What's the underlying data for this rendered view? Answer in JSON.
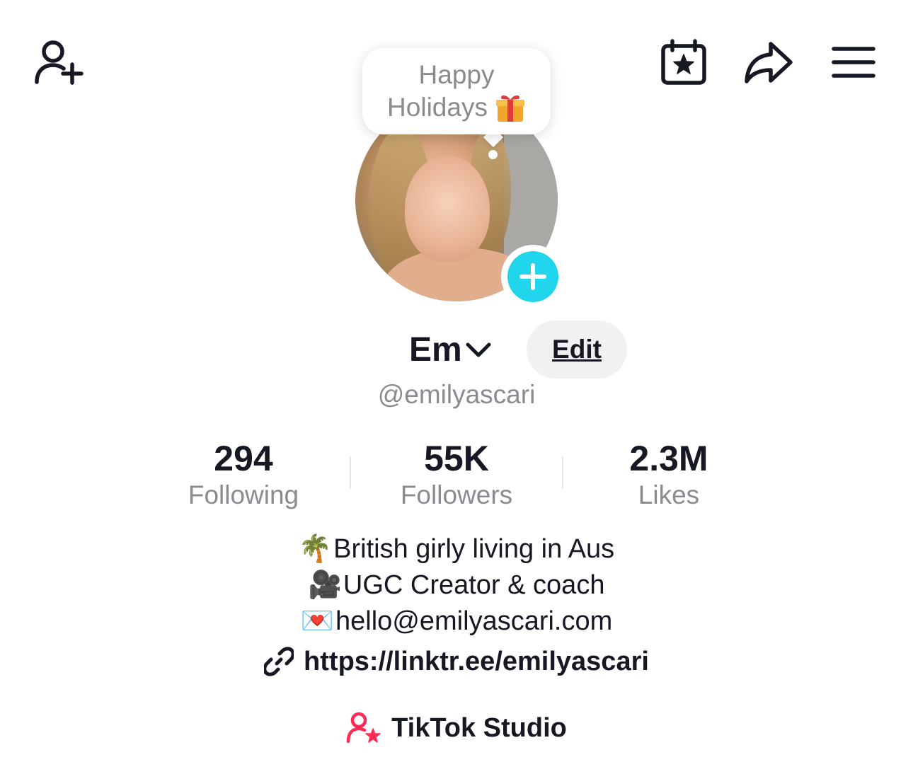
{
  "header": {
    "add_friend_icon": "add-user-icon",
    "calendar_icon": "calendar-star-icon",
    "share_icon": "share-arrow-icon",
    "menu_icon": "hamburger-menu-icon"
  },
  "note_bubble": {
    "line1": "Happy",
    "line2": "Holidays",
    "emoji_icon": "gift-icon"
  },
  "profile": {
    "display_name": "Em",
    "edit_label": "Edit",
    "username": "@emilyascari",
    "add_avatar_icon": "plus-icon"
  },
  "stats": [
    {
      "value": "294",
      "label": "Following"
    },
    {
      "value": "55K",
      "label": "Followers"
    },
    {
      "value": "2.3M",
      "label": "Likes"
    }
  ],
  "bio": {
    "line1_emoji": "🌴",
    "line1_text": "British girly living in Aus",
    "line2_emoji": "🎥",
    "line2_text": "UGC Creator & coach",
    "line3_emoji": "💌",
    "line3_text": "hello@emilyascari.com",
    "link": "https://linktr.ee/emilyascari"
  },
  "studio": {
    "label": "TikTok Studio",
    "icon": "creator-star-icon"
  },
  "colors": {
    "accent_cyan": "#20d5ec",
    "studio_pink": "#fe2c55",
    "text_primary": "#161823",
    "text_secondary": "#8a8b91",
    "button_bg": "#f1f1f2"
  }
}
